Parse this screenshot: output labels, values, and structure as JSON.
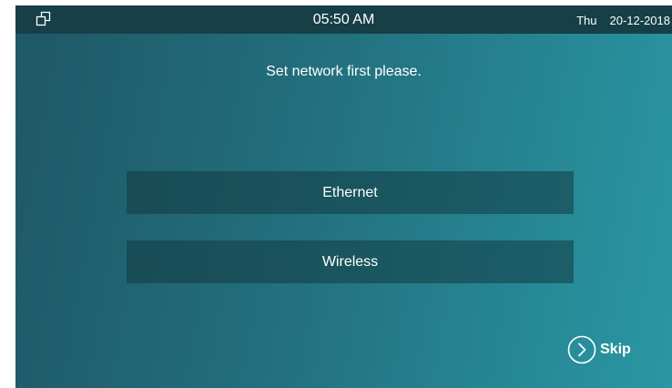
{
  "status_bar": {
    "window_icon": "window-restore-icon",
    "time": "05:50 AM",
    "day": "Thu",
    "date": "20-12-2018"
  },
  "main": {
    "prompt": "Set network first please.",
    "options": [
      {
        "label": "Ethernet"
      },
      {
        "label": "Wireless"
      }
    ],
    "skip": {
      "icon": "chevron-right-circle-icon",
      "label": "Skip"
    }
  },
  "colors": {
    "status_bar_bg": "#163f48",
    "background_start": "#1f5766",
    "background_end": "#2a97a4",
    "button_bg": "#1b4650",
    "text": "#ffffff"
  }
}
